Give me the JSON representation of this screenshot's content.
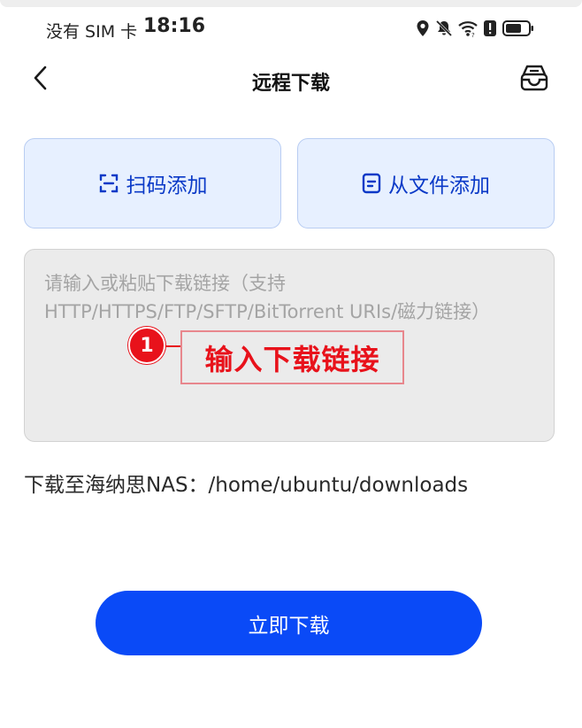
{
  "status_bar": {
    "carrier": "没有 SIM 卡",
    "time": "18:16",
    "icons": [
      "location-icon",
      "bell-off-icon",
      "wifi-icon",
      "alert-icon",
      "battery-icon"
    ]
  },
  "nav": {
    "title": "远程下载",
    "back_icon": "chevron-left-icon",
    "action_icon": "inbox-icon"
  },
  "actions": {
    "scan_label": "扫码添加",
    "scan_icon": "scan-icon",
    "file_label": "从文件添加",
    "file_icon": "file-icon"
  },
  "link_input": {
    "value": "",
    "placeholder": "请输入或粘贴下载链接（支持HTTP/HTTPS/FTP/SFTP/BitTorrent URIs/磁力链接）"
  },
  "annotation": {
    "step_number": "1",
    "text": "输入下载链接",
    "color": "#e8121b"
  },
  "destination": {
    "text": "下载至海纳思NAS：/home/ubuntu/downloads"
  },
  "primary_button": {
    "label": "立即下载",
    "color": "#0a4af7"
  },
  "colors": {
    "accent": "#0a39c7",
    "card_bg": "#e7f0ff",
    "input_bg": "#ebebeb"
  }
}
